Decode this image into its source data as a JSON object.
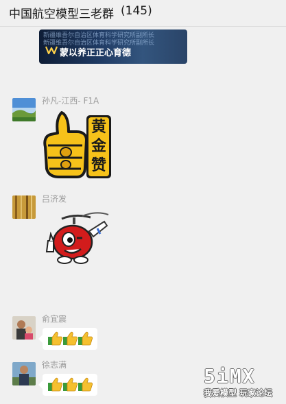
{
  "header": {
    "title": "中国航空模型三老群",
    "member_count": "(145)"
  },
  "banner": {
    "line1": "新疆维吾尔自治区体育科学研究所副所长",
    "line2": "新疆维吾尔自治区体育科学研究所副所长",
    "motto": "蒙以养正正心育德"
  },
  "messages": [
    {
      "sender": "孙凡-江西- F1A",
      "sticker_text": "黄金赞"
    },
    {
      "sender": "吕济发"
    },
    {
      "sender": "俞宜震"
    },
    {
      "sender": "徐志满"
    }
  ],
  "watermark": {
    "logo": "5iMX",
    "tagline": "我爱模型 玩家论坛"
  }
}
